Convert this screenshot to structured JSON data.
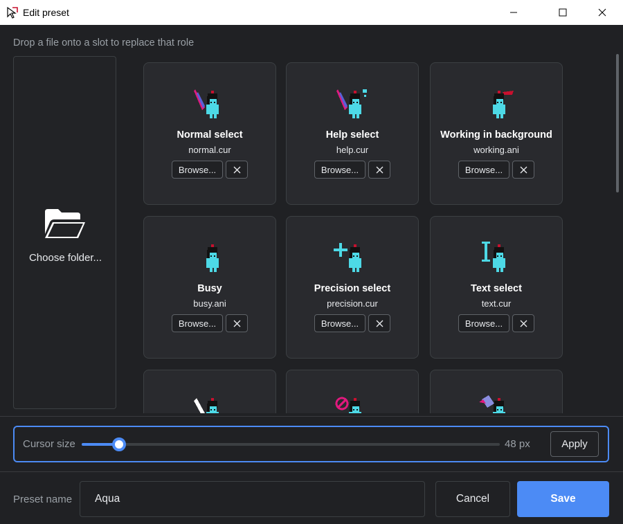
{
  "window": {
    "title": "Edit preset"
  },
  "hint": "Drop a file onto a slot to replace that role",
  "folder": {
    "label": "Choose folder..."
  },
  "cards": [
    {
      "role": "Normal select",
      "file": "normal.cur",
      "browse_label": "Browse...",
      "sprite": "normal-select-cursor-icon"
    },
    {
      "role": "Help select",
      "file": "help.cur",
      "browse_label": "Browse...",
      "sprite": "help-select-cursor-icon"
    },
    {
      "role": "Working in background",
      "file": "working.ani",
      "browse_label": "Browse...",
      "sprite": "working-cursor-icon"
    },
    {
      "role": "Busy",
      "file": "busy.ani",
      "browse_label": "Browse...",
      "sprite": "busy-cursor-icon"
    },
    {
      "role": "Precision select",
      "file": "precision.cur",
      "browse_label": "Browse...",
      "sprite": "precision-cursor-icon"
    },
    {
      "role": "Text select",
      "file": "text.cur",
      "browse_label": "Browse...",
      "sprite": "text-cursor-icon"
    },
    {
      "role": "",
      "file": "",
      "browse_label": "",
      "sprite": "handwriting-cursor-icon"
    },
    {
      "role": "",
      "file": "",
      "browse_label": "",
      "sprite": "unavailable-cursor-icon"
    },
    {
      "role": "",
      "file": "",
      "browse_label": "",
      "sprite": "link-cursor-icon"
    }
  ],
  "cursor_size": {
    "label": "Cursor size",
    "value": 48,
    "value_text": "48 px",
    "fraction": 0.09,
    "apply_label": "Apply"
  },
  "preset": {
    "label": "Preset name",
    "value": "Aqua"
  },
  "actions": {
    "cancel_label": "Cancel",
    "save_label": "Save"
  },
  "colors": {
    "accent": "#4c8bf5",
    "background": "#202124",
    "card": "#292a2e",
    "sprite_cyan": "#4dd9e6",
    "sprite_red": "#c8102e",
    "sprite_magenta": "#e0197d"
  }
}
